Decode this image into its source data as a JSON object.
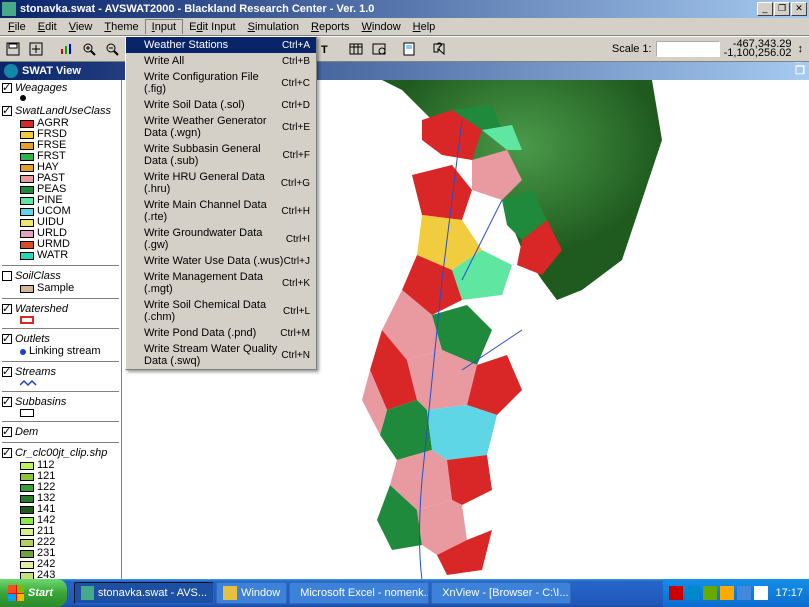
{
  "title": "stonavka.swat - AVSWAT2000 - Blackland Research Center - Ver. 1.0",
  "menus": [
    "File",
    "Edit",
    "View",
    "Theme",
    "Input",
    "Edit Input",
    "Simulation",
    "Reports",
    "Window",
    "Help"
  ],
  "input_menu": [
    {
      "label": "Weather Stations",
      "shortcut": "Ctrl+A"
    },
    {
      "label": "Write  All",
      "shortcut": "Ctrl+B"
    },
    {
      "label": "Write Configuration File (.fig)",
      "shortcut": "Ctrl+C"
    },
    {
      "label": "Write Soil Data (.sol)",
      "shortcut": "Ctrl+D"
    },
    {
      "label": "Write Weather Generator Data (.wgn)",
      "shortcut": "Ctrl+E"
    },
    {
      "label": "Write Subbasin General Data (.sub)",
      "shortcut": "Ctrl+F"
    },
    {
      "label": "Write HRU General Data (.hru)",
      "shortcut": "Ctrl+G"
    },
    {
      "label": "Write Main Channel Data (.rte)",
      "shortcut": "Ctrl+H"
    },
    {
      "label": "Write Groundwater Data (.gw)",
      "shortcut": "Ctrl+I"
    },
    {
      "label": "Write Water Use Data (.wus)",
      "shortcut": "Ctrl+J"
    },
    {
      "label": "Write Management Data (.mgt)",
      "shortcut": "Ctrl+K"
    },
    {
      "label": "Write Soil Chemical Data (.chm)",
      "shortcut": "Ctrl+L"
    },
    {
      "label": "Write Pond Data (.pnd)",
      "shortcut": "Ctrl+M"
    },
    {
      "label": "Write  Stream Water Quality Data (.swq)",
      "shortcut": "Ctrl+N"
    }
  ],
  "scale_label": "Scale 1:",
  "scale_value": "",
  "coord_x": "-467,343.29",
  "coord_y": "-1,100,256.02",
  "swat_view": "SWAT View",
  "layers": {
    "weagages": {
      "name": "Weagages",
      "checked": true
    },
    "landuse": {
      "name": "SwatLandUseClass",
      "checked": true,
      "items": [
        {
          "label": "AGRR",
          "color": "#d92626"
        },
        {
          "label": "FRSD",
          "color": "#f0cc3e"
        },
        {
          "label": "FRSE",
          "color": "#e6a028"
        },
        {
          "label": "FRST",
          "color": "#2eb34a"
        },
        {
          "label": "HAY",
          "color": "#e6a028"
        },
        {
          "label": "PAST",
          "color": "#e89aa0"
        },
        {
          "label": "PEAS",
          "color": "#1f8a3b"
        },
        {
          "label": "PINE",
          "color": "#5fe6a0"
        },
        {
          "label": "UCOM",
          "color": "#5fd6e6"
        },
        {
          "label": "UIDU",
          "color": "#f0e66a"
        },
        {
          "label": "URLD",
          "color": "#e6a0c0"
        },
        {
          "label": "URMD",
          "color": "#d94a26"
        },
        {
          "label": "WATR",
          "color": "#26d9b3"
        }
      ]
    },
    "soilclass": {
      "name": "SoilClass",
      "checked": false,
      "items": [
        {
          "label": "Sample",
          "color": "#d4b896"
        }
      ]
    },
    "watershed": {
      "name": "Watershed",
      "checked": true,
      "items": [
        {
          "label": "",
          "color": "#ffffff",
          "stroke": "#d92626"
        }
      ]
    },
    "outlets": {
      "name": "Outlets",
      "checked": true,
      "items": [
        {
          "label": "Linking stream",
          "color": "#2040d0",
          "pt": true
        }
      ]
    },
    "streams": {
      "name": "Streams",
      "checked": true,
      "line": "#2040d0"
    },
    "subbasins": {
      "name": "Subbasins",
      "checked": true,
      "items": [
        {
          "label": "",
          "color": "#ffffff"
        }
      ]
    },
    "dem": {
      "name": "Dem",
      "checked": true
    },
    "clc": {
      "name": "Cr_clc00jt_clip.shp",
      "checked": true,
      "items": [
        {
          "label": "112",
          "color": "#c0f05a"
        },
        {
          "label": "121",
          "color": "#8ac43a"
        },
        {
          "label": "122",
          "color": "#3a9e3a"
        },
        {
          "label": "132",
          "color": "#2a7a2a"
        },
        {
          "label": "141",
          "color": "#1f5a1f"
        },
        {
          "label": "142",
          "color": "#8ee64a"
        },
        {
          "label": "211",
          "color": "#d6f08a"
        },
        {
          "label": "222",
          "color": "#b0d060"
        },
        {
          "label": "231",
          "color": "#70a040"
        },
        {
          "label": "242",
          "color": "#e0f0a0"
        },
        {
          "label": "243",
          "color": "#c8e078"
        }
      ]
    }
  },
  "taskbar": {
    "start": "Start",
    "buttons": [
      {
        "label": "stonavka.swat - AVS...",
        "active": true,
        "color": "#4a8"
      },
      {
        "label": "Window",
        "active": false,
        "color": "#e6c040"
      },
      {
        "label": "Microsoft Excel - nomenk...",
        "active": false,
        "color": "#1f8a3b"
      },
      {
        "label": "XnView - [Browser - C:\\I...",
        "active": false,
        "color": "#d96a20"
      }
    ],
    "clock": "17:17"
  }
}
